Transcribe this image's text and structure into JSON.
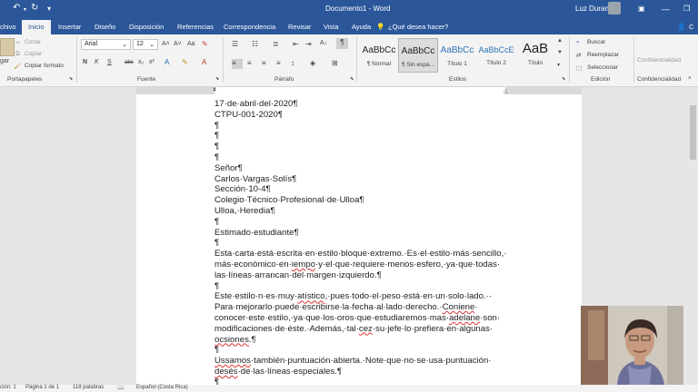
{
  "titlebar": {
    "doc_title": "Documento1 - Word",
    "user": "Luz Duran",
    "undo_icon": "undo-icon",
    "redo_icon": "redo-icon"
  },
  "tabs": [
    {
      "label": "chivo"
    },
    {
      "label": "Inicio"
    },
    {
      "label": "Insertar"
    },
    {
      "label": "Diseño"
    },
    {
      "label": "Disposición"
    },
    {
      "label": "Referencias"
    },
    {
      "label": "Correspondencia"
    },
    {
      "label": "Revisar"
    },
    {
      "label": "Vista"
    },
    {
      "label": "Ayuda"
    },
    {
      "label": "¿Qué desea hacer?"
    }
  ],
  "share_label": "C",
  "clipboard": {
    "paste": "gar",
    "cut": "Cortar",
    "copy": "Copiar",
    "format_painter": "Copiar formato",
    "group": "Portapapeles"
  },
  "font": {
    "family": "Arial",
    "size": "12",
    "bold": "N",
    "italic": "K",
    "underline": "S",
    "strike": "abc",
    "sub": "x₂",
    "sup": "x²",
    "group": "Fuente"
  },
  "paragraph": {
    "group": "Párrafo"
  },
  "styles": {
    "items": [
      {
        "preview": "AaBbCc",
        "name": "¶ Normal"
      },
      {
        "preview": "AaBbCc",
        "name": "¶ Sin espa..."
      },
      {
        "preview": "AaBbCc",
        "name": "Título 1"
      },
      {
        "preview": "AaBbCcE",
        "name": "Título 2"
      },
      {
        "preview": "AaB",
        "name": "Título"
      }
    ],
    "group": "Estilos"
  },
  "editing": {
    "find": "Buscar",
    "replace": "Reemplazar",
    "select": "Seleccionar",
    "group": "Edición"
  },
  "sensitivity": {
    "button": "Confidencialidad",
    "group": "Confidencialidad"
  },
  "document_lines": [
    "17·de·abril·del·2020¶",
    "CTPU-001-2020¶",
    "¶",
    "¶",
    "¶",
    "¶",
    "Señor¶",
    "Carlos·Vargas·Solís¶",
    "Sección·10-4¶",
    "Colegio·Técnico·Profesional·de·Ulloa¶",
    "Ulloa,·Heredia¶",
    "¶",
    "Estimado·estudiante¶",
    "¶",
    "Esta·carta·está·escrita·en·estilo·bloque·extremo.·Es·el·estilo·más·sencillo,·",
    "más·económico·en·iempo·y·el·que·requiere·menos·esfero,·ya·que·todas·",
    "las·líneas·arrancan·del·margen·izquierdo.¶",
    "¶",
    "Este·estilo·n·es·muy·atístico,·pues·todo·el·peso·está·en·un·solo·lado.··",
    "Para·mejorarlo·puede·escribirse·la·fecha·al·lado·derecho.·Coniene·",
    "conocer·este·estilo,·ya·que·los·oros·que·estudiaremos·mas·adelane·son·",
    "modificaciones·de·éste.·Además,·tal·cez·su·jefe·lo·prefiera·en·algunas·",
    "ocsiones.¶",
    "¶",
    "Ussamos·también·puntuación·abierta.·Note·que·no·se·usa·puntuación·",
    "desés·de·las·líneas·especiales.¶",
    "¶"
  ],
  "status": {
    "section": "ción: 1",
    "page": "Página 1 de 1",
    "words": "118 palabras",
    "language": "Español (Costa Rica)"
  },
  "colors": {
    "accent": "#2b579a",
    "ribbon": "#f3f3f3",
    "canvas": "#e6e6e6"
  }
}
